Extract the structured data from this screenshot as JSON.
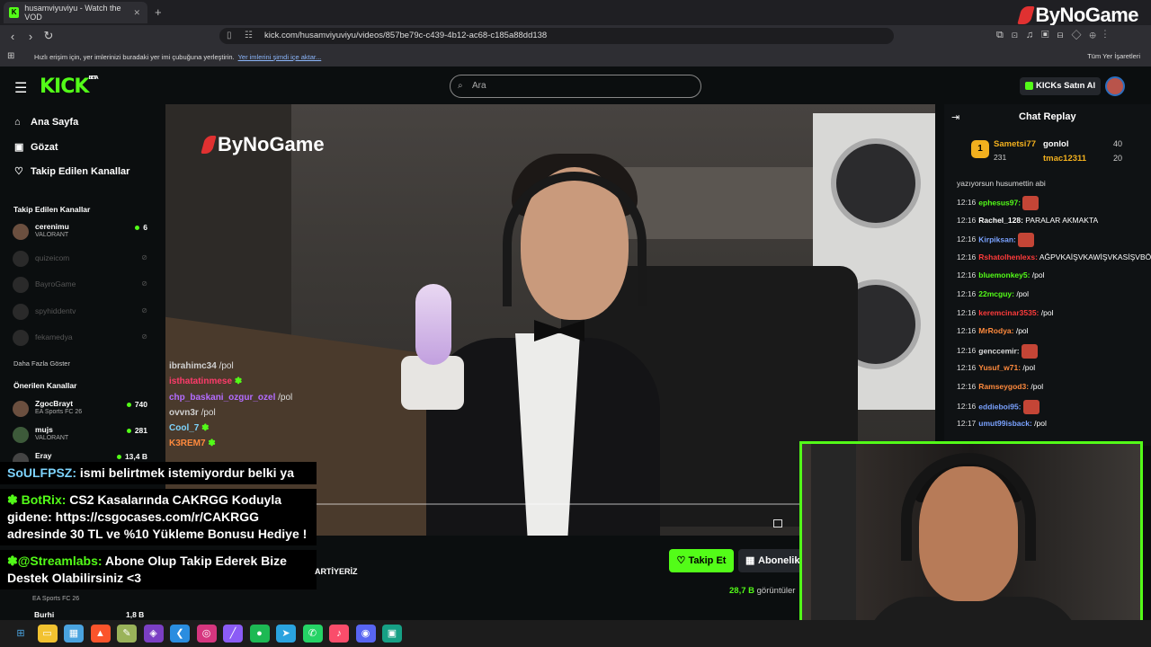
{
  "browser": {
    "tab_title": "husamviyuviyu - Watch the VOD",
    "url": "kick.com/husamviyuviyu/videos/857be79c-c439-4b12-ac68-c185a88dd138",
    "bookmarks_text": "Hızlı erişim için, yer imlerinizi buradaki yer imi çubuğuna yerleştirin.",
    "bookmarks_link": "Yer imlerini şimdi içe aktar...",
    "bookmarks_right": "Tüm Yer İşaretleri",
    "brand": "ByNoGame"
  },
  "header": {
    "logo": "KICK",
    "logo_sup": "BETA",
    "search_placeholder": "Ara",
    "buy_kicks": "KICKs Satın Al"
  },
  "sidebar": {
    "nav": [
      {
        "label": "Ana Sayfa",
        "icon": "home-icon"
      },
      {
        "label": "Gözat",
        "icon": "browse-icon"
      },
      {
        "label": "Takip Edilen Kanallar",
        "icon": "heart-icon"
      }
    ],
    "followed_title": "Takip Edilen Kanallar",
    "followed": [
      {
        "name": "cerenimu",
        "game": "VALORANT",
        "viewers": "6"
      },
      {
        "name": "quizeicom"
      },
      {
        "name": "BayroGame"
      },
      {
        "name": "spyhiddentv"
      },
      {
        "name": "fekamedya"
      }
    ],
    "show_more": "Daha Fazla Göster",
    "recommended_title": "Önerilen Kanallar",
    "recommended": [
      {
        "name": "ZgocBrayt",
        "game": "EA Sports FC 26",
        "viewers": "740"
      },
      {
        "name": "mujs",
        "game": "VALORANT",
        "viewers": "281"
      },
      {
        "name": "Eray",
        "game": "",
        "viewers": "13,4 B"
      }
    ]
  },
  "player": {
    "watermark": "ByNoGame",
    "chat_overlay": [
      {
        "user": "ibrahimc34",
        "text": "/pol",
        "color": "#d0d0d0"
      },
      {
        "user": "isthatatinmese",
        "text": "",
        "color": "#ff3b6b"
      },
      {
        "user": "chp_baskani_ozgur_ozel",
        "text": "/pol",
        "color": "#b46cff"
      },
      {
        "user": "ovvn3r",
        "text": "/pol",
        "color": "#d0d0d0"
      },
      {
        "user": "Cool_7",
        "text": "",
        "color": "#7dd3fc"
      },
      {
        "user": "K3REM7",
        "text": "",
        "color": "#ff8a3d"
      }
    ]
  },
  "alerts": [
    {
      "user": "SoULFPSZ:",
      "text": "ismi belirtmek istemiyordur belki ya"
    },
    {
      "user": "BotRix:",
      "text": "CS2 Kasalarında CAKRGG Koduyla gidene: https://csgocases.com/r/CAKRGG adresinde 30 TL ve %10 Yükleme Bonusu Hediye !"
    },
    {
      "user": "@Streamlabs:",
      "text": "Abone Olup Takip Ederek Bize Destek Olabilirsiniz <3"
    }
  ],
  "under_player": {
    "follow": "Takip Et",
    "subscribe": "Abonelik",
    "views_count": "28,7 B",
    "views_label": "görüntüler",
    "partial_text": "ARTİYERİZ",
    "partial_game": "EA Sports FC 26",
    "partial_user": "Burhi",
    "partial_views": "1,8 B"
  },
  "chat": {
    "title": "Chat Replay",
    "leaderboard": {
      "first": {
        "name": "Sametsi77",
        "count": "231"
      },
      "second": {
        "name": "gonlol",
        "value": "40"
      },
      "third": {
        "name": "tmac12311",
        "value": "20"
      }
    },
    "partial_top": "yazıyorsun husumettin abi",
    "messages": [
      {
        "time": "12:16",
        "user": "ephesus97:",
        "text": "",
        "color": "#53fc18",
        "emote": true
      },
      {
        "time": "12:16",
        "user": "Rachel_128:",
        "text": "PARALAR AKMAKTA",
        "color": "#ffffff",
        "emote": false
      },
      {
        "time": "12:16",
        "user": "Kirpiksan:",
        "text": "",
        "color": "#7aa2ff",
        "emote": true
      },
      {
        "time": "12:16",
        "user": "Rshatolhenlexs:",
        "text": "AĞPVKAİŞVKAWİŞVKASİŞVBÖAB",
        "color": "#ff3b3b",
        "emote": false
      },
      {
        "time": "12:16",
        "user": "bluemonkey5:",
        "text": "/pol",
        "color": "#53fc18",
        "emote": false
      },
      {
        "time": "12:16",
        "user": "22mcguy:",
        "text": "/pol",
        "color": "#53fc18",
        "emote": false
      },
      {
        "time": "12:16",
        "user": "keremcinar3535:",
        "text": "/pol",
        "color": "#ff3b3b",
        "emote": false
      },
      {
        "time": "12:16",
        "user": "MrRodya:",
        "text": "/pol",
        "color": "#ff8a3d",
        "emote": false
      },
      {
        "time": "12:16",
        "user": "genccemir:",
        "text": "",
        "color": "#dddddd",
        "emote": true
      },
      {
        "time": "12:16",
        "user": "Yusuf_w71:",
        "text": "/pol",
        "color": "#ff8a3d",
        "emote": false
      },
      {
        "time": "12:16",
        "user": "Ramseygod3:",
        "text": "/pol",
        "color": "#ff8a3d",
        "emote": false
      },
      {
        "time": "12:16",
        "user": "eddieboi95:",
        "text": "",
        "color": "#7aa2ff",
        "emote": true
      },
      {
        "time": "12:17",
        "user": "umut99isback:",
        "text": "/pol",
        "color": "#7aa2ff",
        "emote": false
      }
    ]
  },
  "taskbar": [
    "windows-icon",
    "explorer-icon",
    "photos-icon",
    "brave-icon",
    "edit-icon",
    "visual-studio-icon",
    "vscode-icon",
    "instagram-icon",
    "pen-icon",
    "spotify-icon",
    "telegram-icon",
    "whatsapp-icon",
    "music-icon",
    "discord-icon",
    "app-icon"
  ]
}
